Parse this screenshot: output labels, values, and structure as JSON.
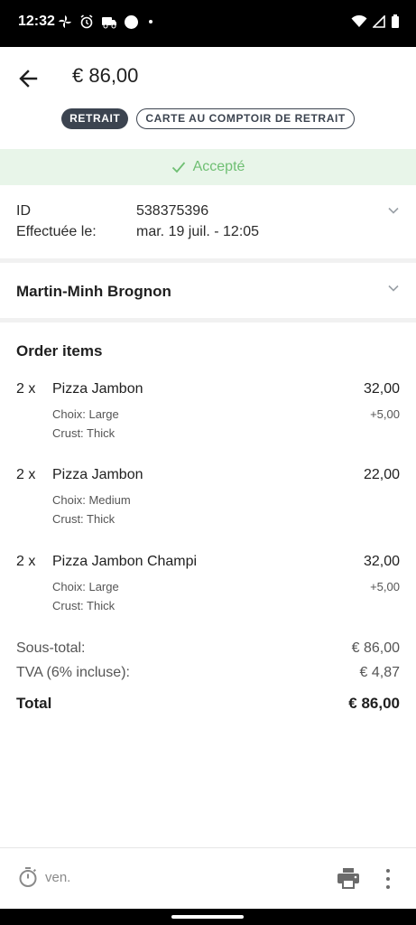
{
  "status_bar": {
    "time": "12:32"
  },
  "header": {
    "title": "€ 86,00",
    "badges": [
      "RETRAIT",
      "CARTE AU COMPTOIR DE RETRAIT"
    ]
  },
  "status": {
    "label": "Accepté",
    "color": "#6fbf73"
  },
  "info": {
    "id_label": "ID",
    "id_value": "538375396",
    "date_label": "Effectuée le:",
    "date_value": "mar. 19 juil. - 12:05"
  },
  "customer": {
    "name": "Martin-Minh Brognon"
  },
  "order": {
    "title": "Order items",
    "items": [
      {
        "qty": "2 x",
        "name": "Pizza Jambon",
        "price": "32,00",
        "options": [
          "Choix: Large",
          "Crust: Thick"
        ],
        "extra": "+5,00"
      },
      {
        "qty": "2 x",
        "name": "Pizza Jambon",
        "price": "22,00",
        "options": [
          "Choix: Medium",
          "Crust: Thick"
        ],
        "extra": ""
      },
      {
        "qty": "2 x",
        "name": "Pizza Jambon Champi",
        "price": "32,00",
        "options": [
          "Choix: Large",
          "Crust: Thick"
        ],
        "extra": "+5,00"
      }
    ]
  },
  "totals": {
    "subtotal_label": "Sous-total:",
    "subtotal_value": "€ 86,00",
    "tax_label": "TVA (6% incluse):",
    "tax_value": "€ 4,87",
    "total_label": "Total",
    "total_value": "€ 86,00"
  },
  "bottom_bar": {
    "timer_label": "ven."
  },
  "icons": {
    "back": "arrow-back-icon",
    "check": "check-icon",
    "expand": "chevron-down-icon",
    "timer": "timer-icon",
    "print": "print-icon",
    "more": "more-vert-icon"
  }
}
